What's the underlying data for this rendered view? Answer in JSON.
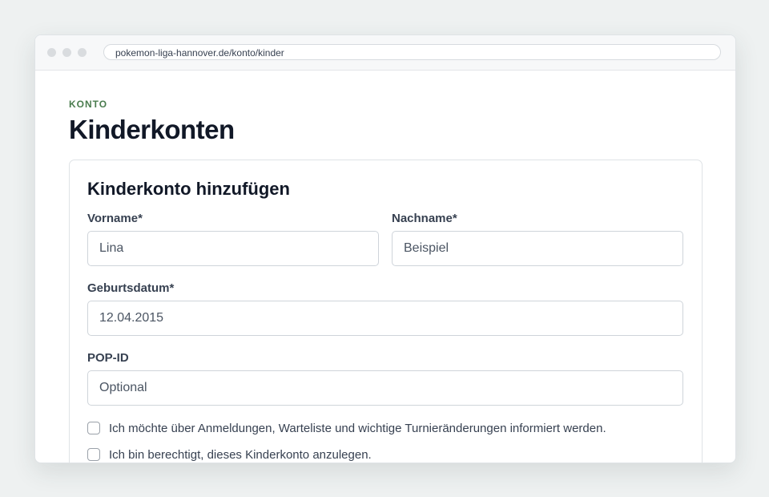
{
  "browser": {
    "url": "pokemon-liga-hannover.de/konto/kinder"
  },
  "page": {
    "eyebrow": "KONTO",
    "title": "Kinderkonten"
  },
  "form": {
    "title": "Kinderkonto hinzufügen",
    "first_name": {
      "label": "Vorname*",
      "value": "Lina"
    },
    "last_name": {
      "label": "Nachname*",
      "value": "Beispiel"
    },
    "birthdate": {
      "label": "Geburtsdatum*",
      "value": "12.04.2015"
    },
    "pop_id": {
      "label": "POP-ID",
      "placeholder": "Optional",
      "value": ""
    },
    "checkboxes": [
      {
        "label": "Ich möchte über Anmeldungen, Warteliste und wichtige Turnieränderungen informiert werden.",
        "checked": false
      },
      {
        "label": "Ich bin berechtigt, dieses Kinderkonto anzulegen.",
        "checked": false
      }
    ]
  }
}
